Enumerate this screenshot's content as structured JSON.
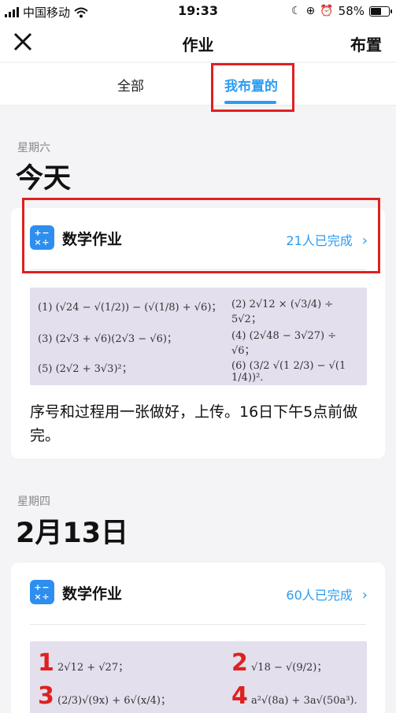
{
  "status_bar": {
    "carrier": "中国移动",
    "time": "19:33",
    "battery": "58%",
    "battery_level": 0.58
  },
  "navbar": {
    "title": "作业",
    "action_label": "布置",
    "close_icon": "close-icon"
  },
  "tabs": [
    {
      "label": "全部",
      "active": false
    },
    {
      "label": "我布置的",
      "active": true
    }
  ],
  "accent_color": "#2b9cf2",
  "highlight_color": "#e02020",
  "sections": [
    {
      "weekday": "星期六",
      "date": "今天",
      "card": {
        "icon": "calculator-icon",
        "title": "数学作业",
        "status": "21人已完成",
        "problems": [
          {
            "num": "(1)",
            "expr": "(√24 − √(1/2)) − (√(1/8) + √6)；"
          },
          {
            "num": "(2)",
            "expr": "2√12 × (√3/4) ÷ 5√2；"
          },
          {
            "num": "(3)",
            "expr": "(2√3 + √6)(2√3 − √6)；"
          },
          {
            "num": "(4)",
            "expr": "(2√48 − 3√27) ÷ √6；"
          },
          {
            "num": "(5)",
            "expr": "(2√2 + 3√3)²；"
          },
          {
            "num": "(6)",
            "expr": "(3/2 √(1 2/3) − √(1 1/4))²."
          }
        ],
        "description": "序号和过程用一张做好，上传。16日下午5点前做完。"
      }
    },
    {
      "weekday": "星期四",
      "date": "2月13日",
      "card": {
        "icon": "calculator-icon",
        "title": "数学作业",
        "status": "60人已完成",
        "problems": [
          {
            "num": "1",
            "expr": "2√12 + √27；"
          },
          {
            "num": "2",
            "expr": "√18 − √(9/2)；"
          },
          {
            "num": "3",
            "expr": "(2/3)√(9x) + 6√(x/4)；"
          },
          {
            "num": "4",
            "expr": "a²√(8a) + 3a√(50a³)."
          }
        ]
      }
    }
  ]
}
